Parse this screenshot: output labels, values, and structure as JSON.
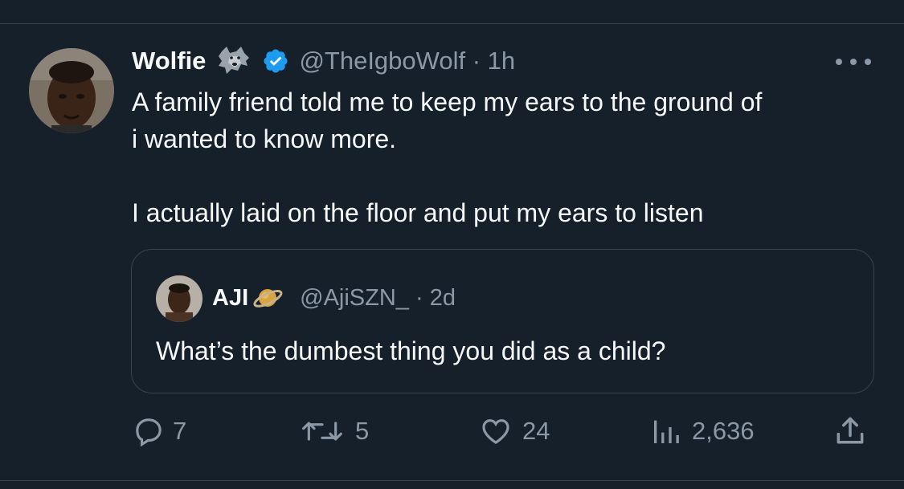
{
  "tweet": {
    "author_name": "Wolfie",
    "author_emoji": "wolf-emoji",
    "verified": true,
    "handle": "@TheIgboWolf",
    "time": "1h",
    "handle_time": "@TheIgboWolf · 1h",
    "text_lines": [
      "A family friend told me to keep my ears to the ground of",
      "i wanted to know more.",
      "I actually laid on the floor and put my ears to listen"
    ]
  },
  "quoted": {
    "author_name": "AJI",
    "author_emoji": "ringed-planet-emoji",
    "handle_time": "@AjiSZN_ · 2d",
    "text": "What’s the dumbest thing you did as a child?"
  },
  "actions": {
    "replies": "7",
    "retweets": "5",
    "likes": "24",
    "views": "2,636"
  },
  "icons": [
    "more-icon",
    "reply-icon",
    "retweet-icon",
    "like-icon",
    "views-icon",
    "share-icon",
    "verified-badge-icon"
  ],
  "colors": {
    "background": "#15202b",
    "text": "#f7f9f9",
    "secondary": "#8b98a5",
    "border": "#38444d",
    "verified": "#1d9bf0"
  }
}
